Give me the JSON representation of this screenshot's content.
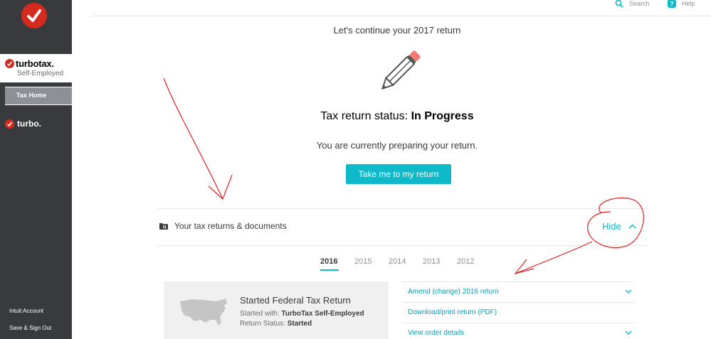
{
  "sidebar": {
    "brand_name": "turbotax.",
    "brand_sub": "Self-Employed",
    "nav_tax_home": "Tax Home",
    "turbo_label": "turbo.",
    "intuit_account": "Intuit Account",
    "save_sign_out": "Save & Sign Out"
  },
  "header": {
    "search_label": "Search",
    "help_label": "Help"
  },
  "main": {
    "title": "Let's continue your 2017 return",
    "status_prefix": "Tax return status: ",
    "status_value": "In Progress",
    "status_desc": "You are currently preparing your return.",
    "cta_label": "Take me to my return"
  },
  "documents": {
    "section_label": "Your tax returns & documents",
    "hide_label": "Hide",
    "years": [
      "2016",
      "2015",
      "2014",
      "2013",
      "2012"
    ],
    "active_year": "2016",
    "card": {
      "title": "Started Federal Tax Return",
      "started_with_label": "Started with: ",
      "started_with_value": "TurboTax Self-Employed",
      "status_label": "Return Status: ",
      "status_value": "Started"
    },
    "links": [
      "Amend (change) 2016 return",
      "Download/print return (PDF)",
      "View order details"
    ]
  },
  "colors": {
    "sidebar_bg": "#393a3d",
    "accent": "#0eb9c9",
    "brand_red": "#d52b1e",
    "annotation_red": "#e02020"
  }
}
